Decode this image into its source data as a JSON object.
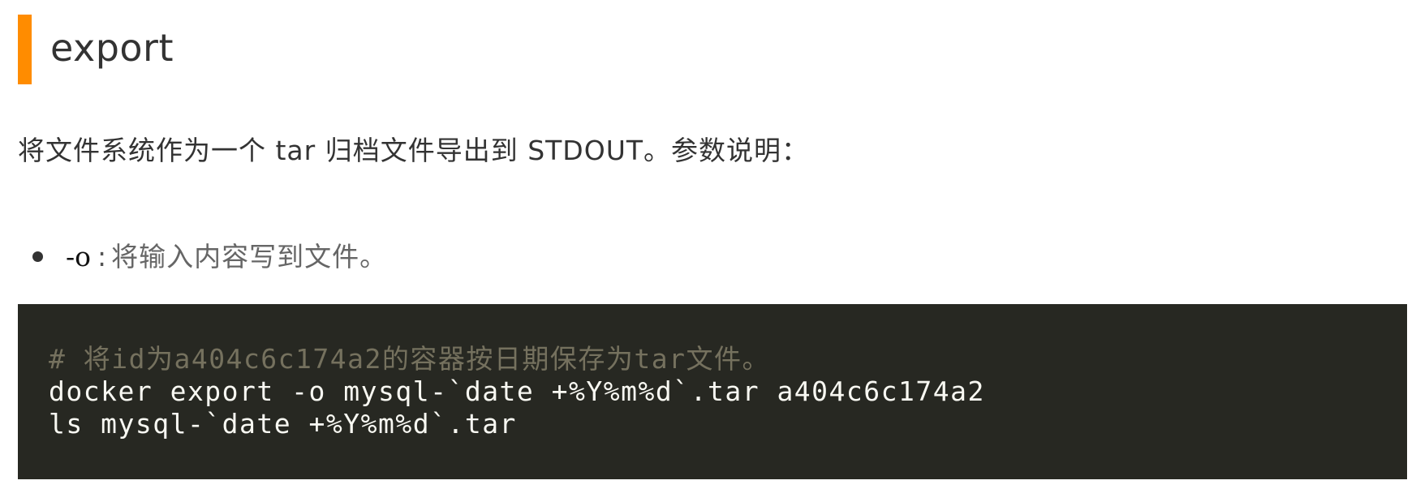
{
  "section": {
    "title": "export",
    "accent_color": "#ff8c00"
  },
  "intro": "将文件系统作为一个 tar 归档文件导出到 STDOUT。参数说明：",
  "params": [
    {
      "flag": "-o",
      "separator": ":",
      "description": "将输入内容写到文件。"
    }
  ],
  "code": {
    "background": "#272822",
    "lines": [
      {
        "kind": "comment",
        "text": "# 将id为a404c6c174a2的容器按日期保存为tar文件。"
      },
      {
        "kind": "code",
        "text": "docker export -o mysql-`date +%Y%m%d`.tar a404c6c174a2"
      },
      {
        "kind": "code",
        "text": "ls mysql-`date +%Y%m%d`.tar"
      }
    ]
  }
}
